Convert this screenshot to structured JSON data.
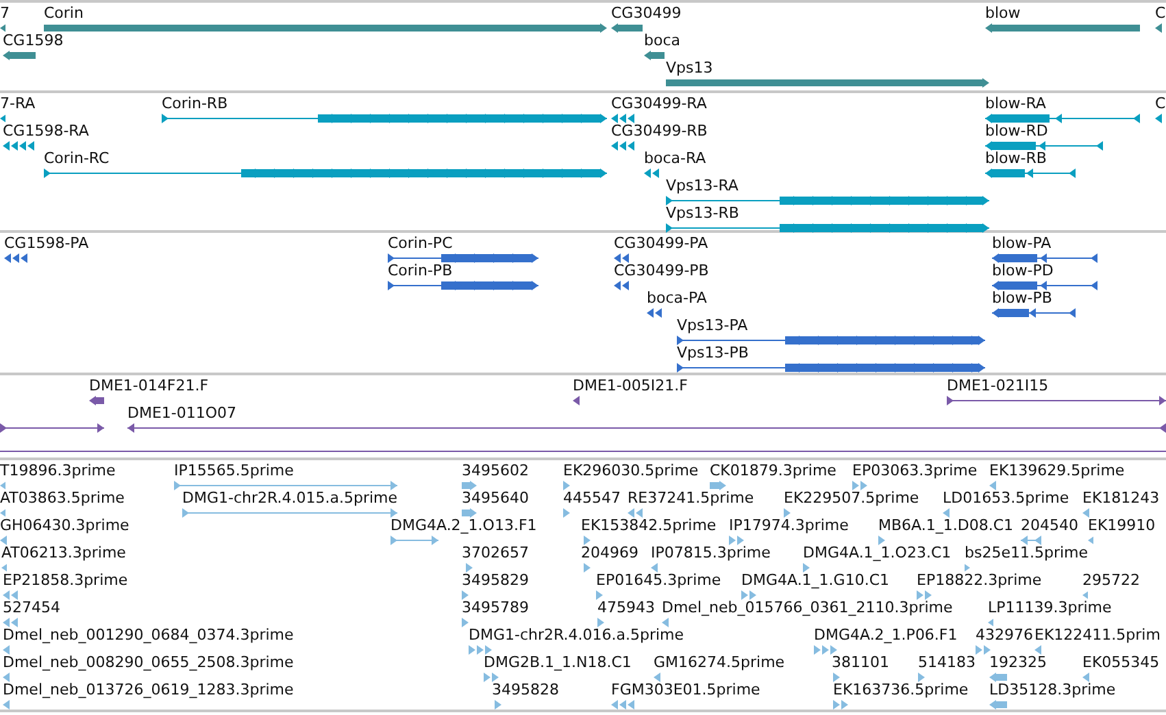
{
  "tracks": [
    {
      "color": "#3f8f94",
      "features": [
        {
          "label": "7",
          "reverse": true
        },
        {
          "label": "Corin",
          "reverse": false
        },
        {
          "label": "CG1598",
          "reverse": true
        },
        {
          "label": "CG30499",
          "reverse": true
        },
        {
          "label": "boca",
          "reverse": true
        },
        {
          "label": "Vps13",
          "reverse": false
        },
        {
          "label": "blow",
          "reverse": true
        },
        {
          "label": "C",
          "reverse": true
        }
      ]
    },
    {
      "color": "#0a9fc0",
      "features": [
        {
          "label": "7-RA",
          "reverse": true
        },
        {
          "label": "Corin-RB",
          "reverse": false
        },
        {
          "label": "CG1598-RA",
          "reverse": true
        },
        {
          "label": "Corin-RC",
          "reverse": false
        },
        {
          "label": "CG30499-RA",
          "reverse": true
        },
        {
          "label": "CG30499-RB",
          "reverse": true
        },
        {
          "label": "boca-RA",
          "reverse": true
        },
        {
          "label": "Vps13-RA",
          "reverse": false
        },
        {
          "label": "Vps13-RB",
          "reverse": false
        },
        {
          "label": "blow-RA",
          "reverse": true
        },
        {
          "label": "blow-RD",
          "reverse": true
        },
        {
          "label": "blow-RB",
          "reverse": true
        },
        {
          "label": "C",
          "reverse": true
        }
      ]
    },
    {
      "color": "#3570cc",
      "features": [
        {
          "label": "CG1598-PA",
          "reverse": true
        },
        {
          "label": "Corin-PC",
          "reverse": false
        },
        {
          "label": "Corin-PB",
          "reverse": false
        },
        {
          "label": "CG30499-PA",
          "reverse": true
        },
        {
          "label": "CG30499-PB",
          "reverse": true
        },
        {
          "label": "boca-PA",
          "reverse": true
        },
        {
          "label": "Vps13-PA",
          "reverse": false
        },
        {
          "label": "Vps13-PB",
          "reverse": false
        },
        {
          "label": "blow-PA",
          "reverse": true
        },
        {
          "label": "blow-PD",
          "reverse": true
        },
        {
          "label": "blow-PB",
          "reverse": true
        }
      ]
    },
    {
      "color": "#7a5aa8",
      "features": [
        {
          "label": "DME1-014F21.F",
          "reverse": true
        },
        {
          "reverse": false
        },
        {
          "label": "DME1-011O07",
          "reverse": true
        },
        {
          "label": "DME1-005I21.F",
          "reverse": true
        },
        {
          "label": "DME1-021I15",
          "reverse": false
        }
      ]
    },
    {
      "color": "#86bce0",
      "features": [
        {
          "label": "T19896.3prime",
          "reverse": true
        },
        {
          "label": "IP15565.5prime",
          "reverse": false
        },
        {
          "label": "3495602",
          "reverse": false
        },
        {
          "label": "EK296030.5prime",
          "reverse": false
        },
        {
          "label": "CK01879.3prime",
          "reverse": false
        },
        {
          "label": "EP03063.3prime",
          "reverse": false
        },
        {
          "label": "EK139629.5prime",
          "reverse": true
        },
        {
          "label": "AT03863.5prime",
          "reverse": true
        },
        {
          "label": "DMG1-chr2R.4.015.a.5prime",
          "reverse": false
        },
        {
          "label": "3495640",
          "reverse": false
        },
        {
          "label": "445547",
          "reverse": false
        },
        {
          "label": "RE37241.5prime",
          "reverse": true
        },
        {
          "label": "EK229507.5prime",
          "reverse": false
        },
        {
          "label": "LD01653.5prime",
          "reverse": true
        },
        {
          "label": "EK181243",
          "reverse": true
        },
        {
          "label": "GH06430.3prime",
          "reverse": true
        },
        {
          "label": "DMG4A.2_1.O13.F1",
          "reverse": false
        },
        {
          "label": "EK153842.5prime",
          "reverse": false
        },
        {
          "label": "IP17974.3prime",
          "reverse": false
        },
        {
          "label": "MB6A.1_1.D08.C1",
          "reverse": false
        },
        {
          "label": "204540",
          "reverse": true
        },
        {
          "label": "EK19910",
          "reverse": true
        },
        {
          "label": "AT06213.3prime",
          "reverse": true
        },
        {
          "label": "3702657",
          "reverse": false
        },
        {
          "label": "204969",
          "reverse": false
        },
        {
          "label": "IP07815.3prime",
          "reverse": true
        },
        {
          "label": "DMG4A.1_1.O23.C1",
          "reverse": false
        },
        {
          "label": "bs25e11.5prime",
          "reverse": false
        },
        {
          "label": "EP21858.3prime",
          "reverse": true
        },
        {
          "label": "3495829",
          "reverse": false
        },
        {
          "label": "EP01645.3prime",
          "reverse": false
        },
        {
          "label": "DMG4A.1_1.G10.C1",
          "reverse": false
        },
        {
          "label": "EP18822.3prime",
          "reverse": false
        },
        {
          "label": "295722",
          "reverse": true
        },
        {
          "label": "527454",
          "reverse": true
        },
        {
          "label": "3495789",
          "reverse": false
        },
        {
          "label": "475943",
          "reverse": false
        },
        {
          "label": "Dmel_neb_015766_0361_2110.3prime",
          "reverse": true
        },
        {
          "label": "LP11139.3prime",
          "reverse": true
        },
        {
          "label": "Dmel_neb_001290_0684_0374.3prime",
          "reverse": true
        },
        {
          "label": "DMG1-chr2R.4.016.a.5prime",
          "reverse": false
        },
        {
          "label": "DMG4A.2_1.P06.F1",
          "reverse": false
        },
        {
          "label": "432976",
          "reverse": false
        },
        {
          "label": "EK122411.5prim",
          "reverse": true
        },
        {
          "label": "Dmel_neb_008290_0655_2508.3prime",
          "reverse": true
        },
        {
          "label": "DMG2B.1_1.N18.C1",
          "reverse": false
        },
        {
          "label": "GM16274.5prime",
          "reverse": true
        },
        {
          "label": "381101",
          "reverse": false
        },
        {
          "label": "514183",
          "reverse": false
        },
        {
          "label": "192325",
          "reverse": true
        },
        {
          "label": "EK055345",
          "reverse": true
        },
        {
          "label": "Dmel_neb_013726_0619_1283.3prime",
          "reverse": true
        },
        {
          "label": "3495828",
          "reverse": false
        },
        {
          "label": "FGM303E01.5prime",
          "reverse": true
        },
        {
          "label": "EK163736.5prime",
          "reverse": false
        },
        {
          "label": "LD35128.3prime",
          "reverse": true
        }
      ]
    }
  ]
}
